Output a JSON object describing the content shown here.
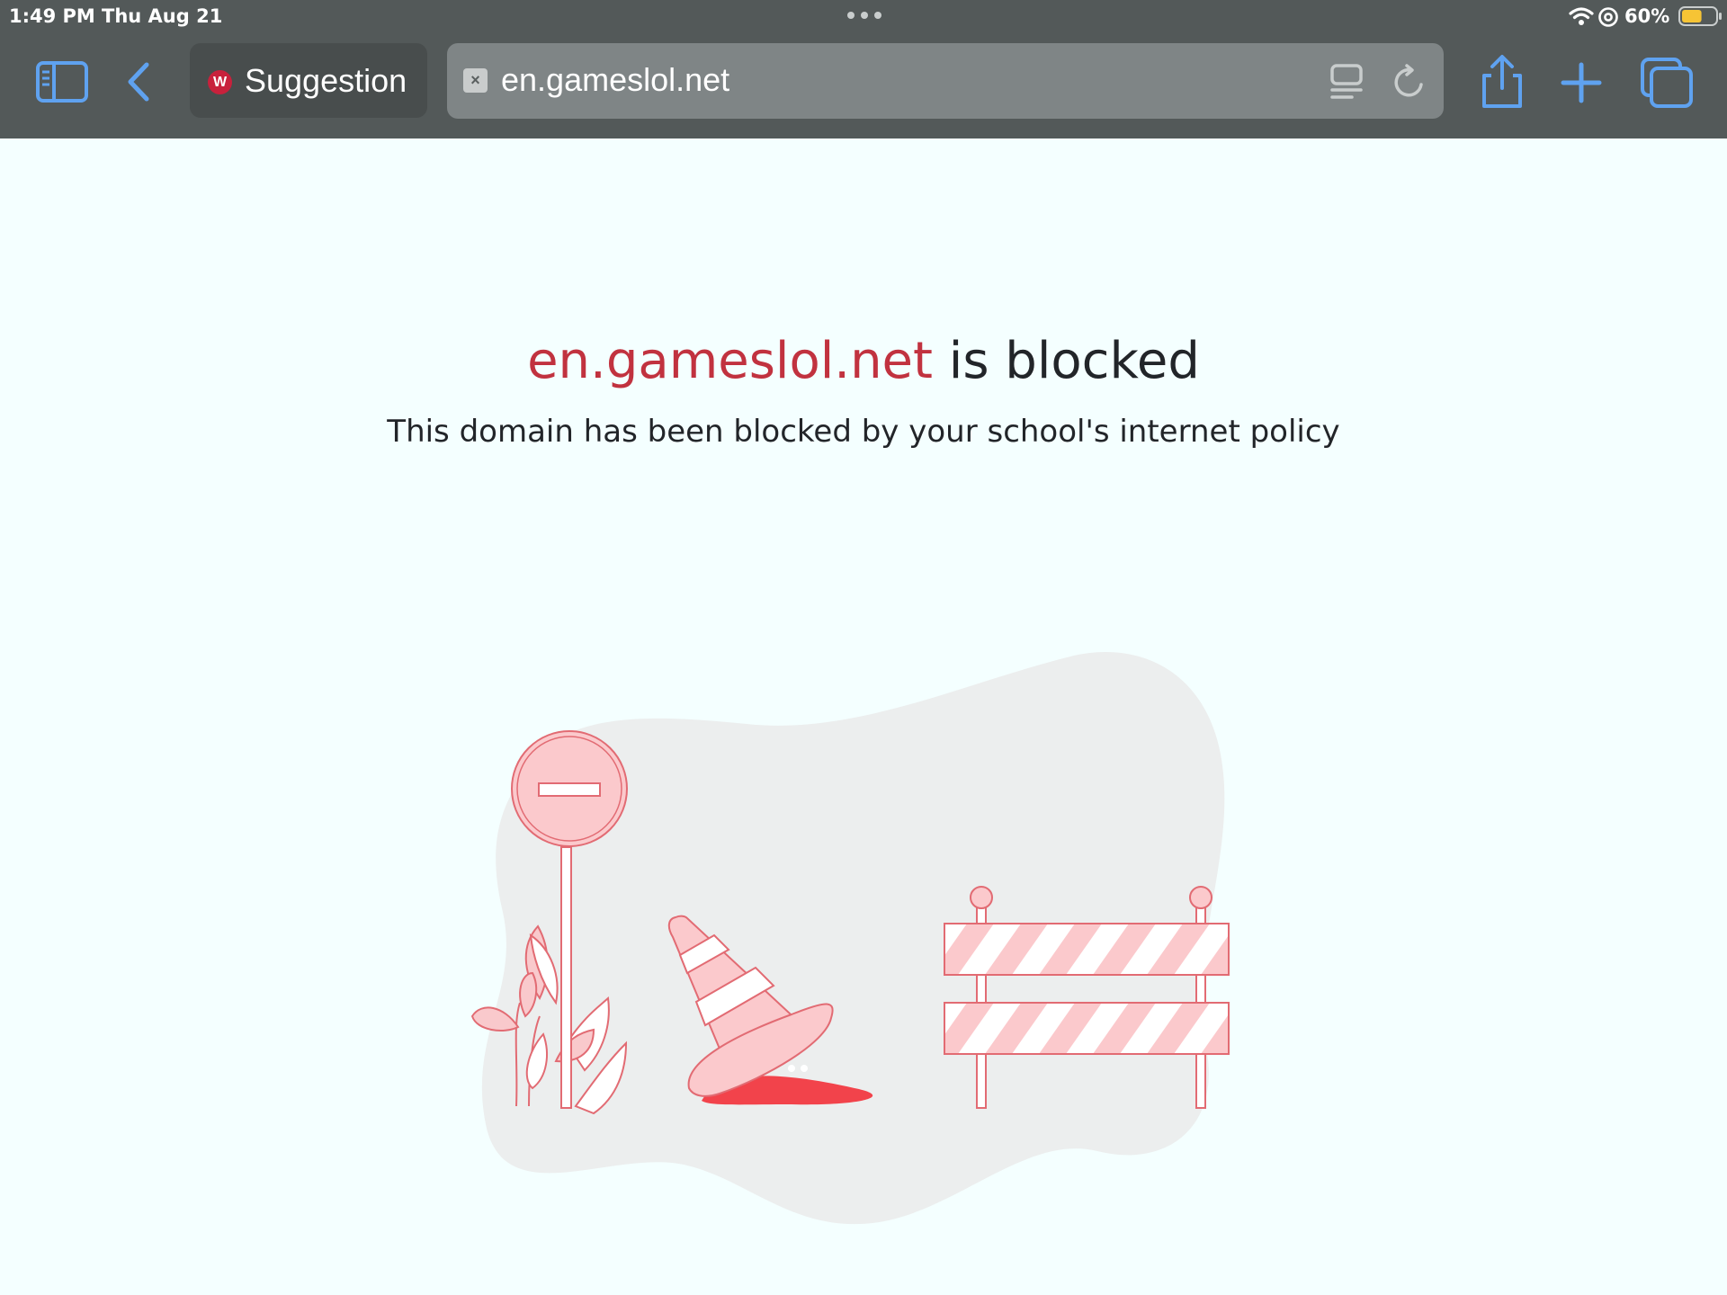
{
  "status_bar": {
    "time": "1:49 PM",
    "date": "Thu Aug 21",
    "battery": "60%",
    "battery_level": 0.6,
    "icons": [
      "multitasking-dots-icon",
      "wifi-icon",
      "at-sign-icon",
      "battery-icon"
    ]
  },
  "toolbar": {
    "icons": [
      "sidebar-icon",
      "back-chevron-icon",
      "share-icon",
      "plus-icon",
      "tab-overview-icon"
    ],
    "accent_color": "#5fa2f0"
  },
  "tabs": {
    "inactive": {
      "favicon_letter": "W",
      "title": "Suggestion"
    }
  },
  "address_bar": {
    "favicon_glyph": "×",
    "url": "en.gameslol.net",
    "icons": [
      "reader-icon",
      "reload-icon"
    ]
  },
  "page": {
    "domain": "en.gameslol.net",
    "heading_suffix": " is blocked",
    "message": "This domain has been blocked by your school's internet policy",
    "accent_color": "#c1323f",
    "illustration_icons": [
      "no-entry-sign-icon",
      "traffic-cone-icon",
      "road-barrier-icon",
      "plant-icon"
    ]
  }
}
